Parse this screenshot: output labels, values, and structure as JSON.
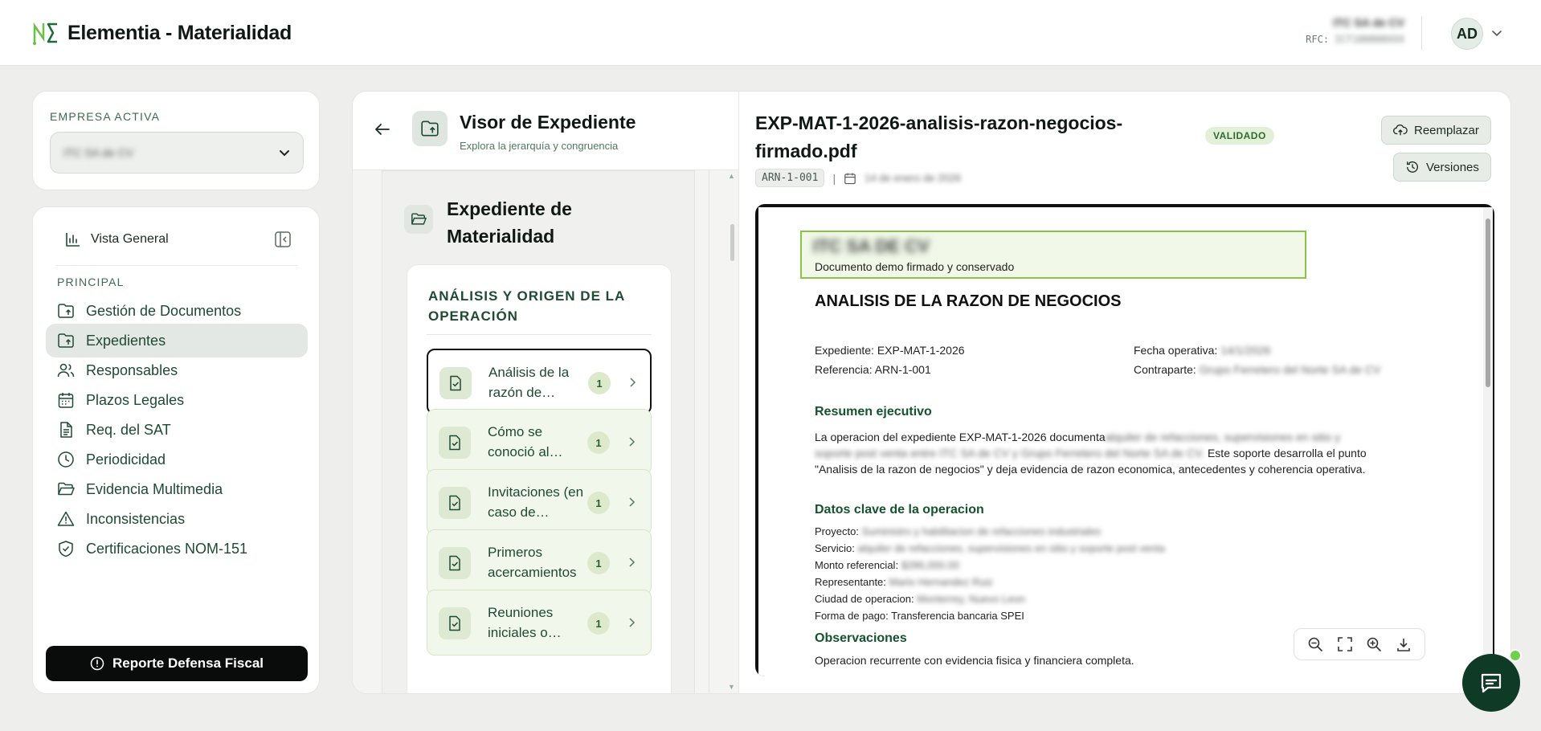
{
  "app": {
    "title": "Elementia - Materialidad"
  },
  "header": {
    "company_name": "ITC SA de CV",
    "rfc_label": "RFC:",
    "rfc_value": "ICT180808XXX",
    "avatar_initials": "AD"
  },
  "company_card": {
    "label": "EMPRESA ACTIVA",
    "selected": "ITC SA de CV"
  },
  "sidebar": {
    "overview_label": "Vista General",
    "section_label": "PRINCIPAL",
    "items": [
      {
        "label": "Gestión de Documentos",
        "icon": "folder-upload-icon"
      },
      {
        "label": "Expedientes",
        "icon": "folder-upload-icon"
      },
      {
        "label": "Responsables",
        "icon": "users-icon"
      },
      {
        "label": "Plazos Legales",
        "icon": "calendar-icon"
      },
      {
        "label": "Req. del SAT",
        "icon": "document-icon"
      },
      {
        "label": "Periodicidad",
        "icon": "clock-icon"
      },
      {
        "label": "Evidencia Multimedia",
        "icon": "folder-open-icon"
      },
      {
        "label": "Inconsistencias",
        "icon": "warning-icon"
      },
      {
        "label": "Certificaciones NOM-151",
        "icon": "shield-check-icon"
      }
    ],
    "report_button": "Reporte Defensa Fiscal"
  },
  "viewer": {
    "title": "Visor de Expediente",
    "subtitle": "Explora la jerarquía y congruencia",
    "expediente_title": "Expediente de Materialidad",
    "section_title": "ANÁLISIS Y ORIGEN DE LA OPERACIÓN",
    "doc_items": [
      {
        "label": "Análisis de la razón de…",
        "count": "1"
      },
      {
        "label": "Cómo se conoció al…",
        "count": "1"
      },
      {
        "label": "Invitaciones (en caso de…",
        "count": "1"
      },
      {
        "label": "Primeros acercamientos",
        "count": "1"
      },
      {
        "label": "Reuniones iniciales o…",
        "count": "1"
      }
    ]
  },
  "document": {
    "file_name": "EXP-MAT-1-2026-analisis-razon-negocios-firmado.pdf",
    "status": "VALIDADO",
    "code": "ARN-1-001",
    "meta_separator": "|",
    "date": "14 de enero de 2026",
    "replace_button": "Reemplazar",
    "versions_button": "Versiones"
  },
  "pdf": {
    "company": "ITC SA DE CV",
    "header_sub": "Documento demo firmado y conservado",
    "heading": "ANALISIS DE LA RAZON DE NEGOCIOS",
    "expediente_label": "Expediente:",
    "expediente_value": "EXP-MAT-1-2026",
    "referencia_label": "Referencia:",
    "referencia_value": "ARN-1-001",
    "fecha_label": "Fecha operativa:",
    "fecha_value": "14/1/2026",
    "contraparte_label": "Contraparte:",
    "contraparte_value": "Grupo Ferretero del Norte SA de CV",
    "resumen_heading": "Resumen ejecutivo",
    "resumen_start": "La operacion del expediente EXP-MAT-1-2026 documenta",
    "resumen_blurred": "alquiler de refacciones, supervisiones en sitio y soporte post venta entre ITC SA de CV y Grupo Ferretero del Norte SA de CV.",
    "resumen_end": "Este soporte desarrolla el punto \"Analisis de la razon de negocios\" y deja evidencia de razon economica, antecedentes y coherencia operativa.",
    "datos_heading": "Datos clave de la operacion",
    "proyecto_label": "Proyecto:",
    "proyecto_value": "Suministro y habilitacion de refacciones industriales",
    "servicio_label": "Servicio:",
    "servicio_value": "alquiler de refacciones, supervisiones en sitio y soporte post venta",
    "monto_label": "Monto referencial:",
    "monto_value": "$286,000.00",
    "representante_label": "Representante:",
    "representante_value": "Mario Hernandez Ruiz",
    "ciudad_label": "Ciudad de operacion:",
    "ciudad_value": "Monterrey, Nuevo Leon",
    "forma_label": "Forma de pago:",
    "forma_value": "Transferencia bancaria SPEI",
    "obs_heading": "Observaciones",
    "obs_text": "Operacion recurrente con evidencia fisica y financiera completa."
  }
}
